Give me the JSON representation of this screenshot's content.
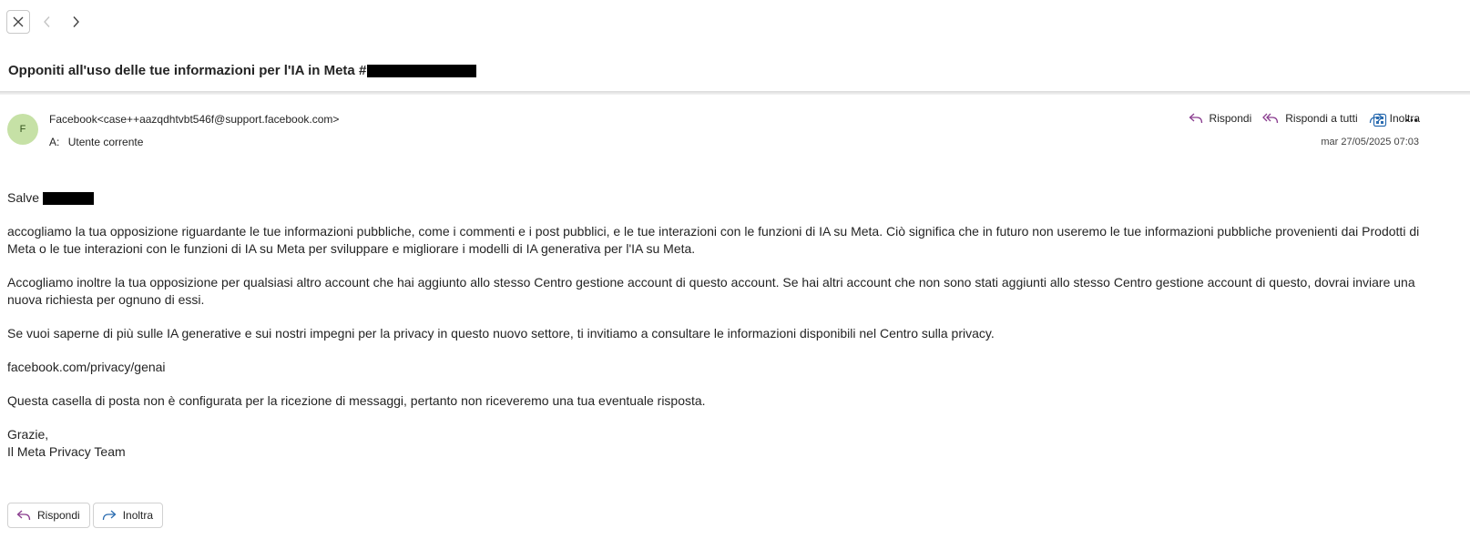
{
  "toolbar": {
    "close_icon": "close-icon",
    "prev_icon": "chevron-left-icon",
    "next_icon": "chevron-right-icon"
  },
  "subject": {
    "text": "Opponiti all'uso delle tue informazioni per l'IA in Meta #"
  },
  "message": {
    "avatar_initial": "F",
    "sender": "Facebook<case++aazqdhtvbt546f@support.facebook.com>",
    "to_label": "A:",
    "to_value": "Utente corrente",
    "date": "mar 27/05/2025 07:03"
  },
  "actions": {
    "reply": "Rispondi",
    "reply_all": "Rispondi a tutti",
    "forward": "Inoltra"
  },
  "body": {
    "greeting": "Salve",
    "p1": "accogliamo la tua opposizione riguardante le tue informazioni pubbliche, come i commenti e i post pubblici, e le tue interazioni con le funzioni di IA su Meta. Ciò significa che in futuro non useremo le tue informazioni pubbliche provenienti dai Prodotti di Meta o le tue interazioni con le funzioni di IA su Meta per sviluppare e migliorare i modelli di IA generativa per l'IA su Meta.",
    "p2": "Accogliamo inoltre la tua opposizione per qualsiasi altro account che hai aggiunto allo stesso Centro gestione account di questo account. Se hai altri account che non sono stati aggiunti allo stesso Centro gestione account di questo, dovrai inviare una nuova richiesta per ognuno di essi.",
    "p3": "Se vuoi saperne di più sulle IA generative e sui nostri impegni per la privacy in questo nuovo settore, ti invitiamo a consultare le informazioni disponibili nel Centro sulla privacy.",
    "link": "facebook.com/privacy/genai",
    "p4": "Questa casella di posta non è configurata per la ricezione di messaggi, pertanto non riceveremo una tua eventuale risposta.",
    "closing": "Grazie,",
    "signature": "Il Meta Privacy Team"
  },
  "bottom": {
    "reply": "Rispondi",
    "forward": "Inoltra"
  },
  "colors": {
    "reply_icon": "#8a3d8f",
    "forward_icon": "#2b6cb0",
    "avatar_bg": "#c6e1a6"
  }
}
